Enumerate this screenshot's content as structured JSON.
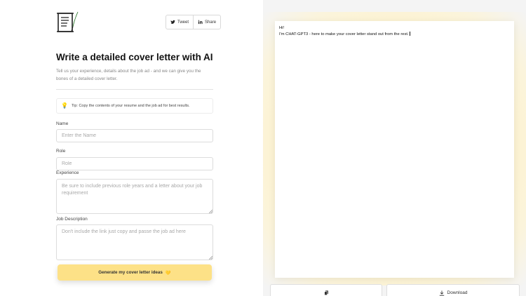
{
  "header": {
    "logo_icon": "scroll-quill-icon",
    "share": [
      {
        "label": "Tweet",
        "icon": "twitter-icon"
      },
      {
        "label": "Share",
        "icon": "linkedin-icon"
      }
    ]
  },
  "main": {
    "title": "Write a detailed cover letter with AI",
    "subtitle": "Tell us your experience, details about the job ad - and we can give you the bones of a detailed cover letter.",
    "tip": {
      "icon": "lightbulb-icon",
      "text": "Tip: Copy the contents of your resume and the job ad for best results."
    },
    "form": {
      "name": {
        "label": "Name",
        "placeholder": "Enter the Name",
        "value": ""
      },
      "role": {
        "label": "Role",
        "placeholder": "Role",
        "value": ""
      },
      "experience": {
        "label": "Experience",
        "placeholder": "Be sure to include previous role years and a letter about your job requirement",
        "value": ""
      },
      "job_description": {
        "label": "Job Description",
        "placeholder": "Don't include the link just copy and passe the job ad here",
        "value": ""
      }
    },
    "generate_label": "Generate my cover letter ideas",
    "generate_emoji": "💛"
  },
  "output": {
    "lines": [
      "Hi!",
      "I'm CHAT-GPT3 - here to make your cover letter stand out from the rest."
    ],
    "copy_icon": "copy-icon",
    "download_label": "Download",
    "download_icon": "download-icon"
  },
  "colors": {
    "accent": "#fde187",
    "glow": "#fff3c9",
    "panel_bg": "#f4f4f4"
  }
}
